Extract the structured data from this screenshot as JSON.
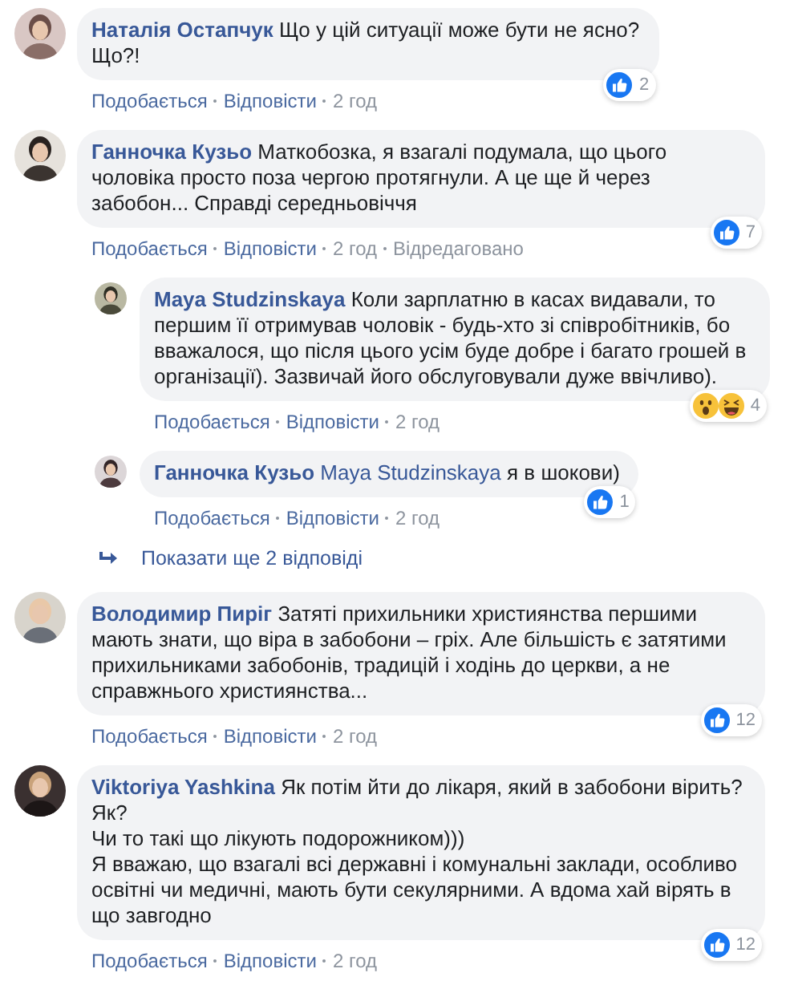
{
  "comments": [
    {
      "kind": "comment",
      "author": "Наталія Остапчук",
      "text": "Що у цій ситуації може бути не ясно?\nЩо?!",
      "reactions": [
        {
          "kind": "like"
        }
      ],
      "reaction_count": "2",
      "actions": {
        "like": "Подобається",
        "reply": "Відповісти",
        "time": "2 год"
      },
      "avatar": {
        "kind": "picture"
      }
    },
    {
      "kind": "comment",
      "author": "Ганночка Кузьо",
      "text": "Маткобозка, я взагалі подумала, що цього чоловіка просто поза чергою протягнули. А це ще й через забобон... Справді середньовіччя",
      "reactions": [
        {
          "kind": "like"
        }
      ],
      "reaction_count": "7",
      "actions": {
        "like": "Подобається",
        "reply": "Відповісти",
        "time": "2 год",
        "edited": "Відредаговано"
      },
      "avatar": {
        "kind": "picture"
      },
      "replies": [
        {
          "kind": "reply",
          "author": "Maya Studzinskaya",
          "text": "Коли зарплатню в касах видавали, то першим її отримував чоловік - будь-хто зі співробітників, бо вважалося, що після цього усім буде добре і багато грошей в організації). Зазвичай його обслуговували дуже ввічливо).",
          "reactions": [
            {
              "kind": "wow"
            },
            {
              "kind": "haha"
            }
          ],
          "reaction_count": "4",
          "actions": {
            "like": "Подобається",
            "reply": "Відповісти",
            "time": "2 год"
          },
          "avatar": {
            "kind": "picture"
          }
        },
        {
          "kind": "reply",
          "author": "Ганночка Кузьо",
          "mention": "Maya Studzinskaya",
          "text": "я в шокови)",
          "reactions": [
            {
              "kind": "like"
            }
          ],
          "reaction_count": "1",
          "actions": {
            "like": "Подобається",
            "reply": "Відповісти",
            "time": "2 год"
          },
          "avatar": {
            "kind": "picture"
          }
        }
      ],
      "more_replies": "Показати ще 2 відповіді"
    },
    {
      "kind": "comment",
      "author": "Володимир Пиріг",
      "text": "Затяті прихильники християнства першими мають знати, що віра в забобони – гріх. Але більшість є затятими прихильниками забобонів, традицій і ходінь до церкви, а не справжнього християнства...",
      "reactions": [
        {
          "kind": "like"
        }
      ],
      "reaction_count": "12",
      "actions": {
        "like": "Подобається",
        "reply": "Відповісти",
        "time": "2 год"
      },
      "avatar": {
        "kind": "picture"
      }
    },
    {
      "kind": "comment",
      "author": "Viktoriya Yashkina",
      "text": "Як потім йти до лікаря, який в забобони вірить?\nЯк?\nЧи то такі що лікують подорожником)))\nЯ вважаю, що взагалі всі державні і комунальні заклади, особливо освітні чи медичні, мають бути секулярними. А вдома хай вірять в що завгодно",
      "reactions": [
        {
          "kind": "like"
        }
      ],
      "reaction_count": "12",
      "actions": {
        "like": "Подобається",
        "reply": "Відповісти",
        "time": "2 год"
      },
      "avatar": {
        "kind": "picture"
      }
    }
  ]
}
